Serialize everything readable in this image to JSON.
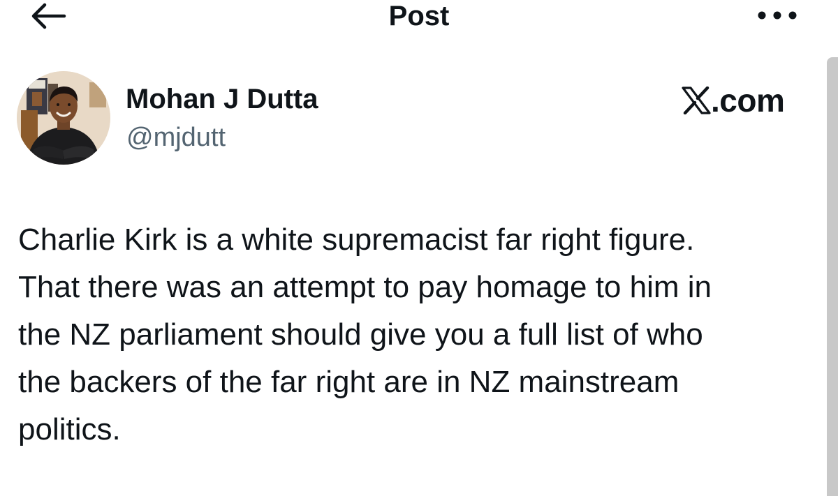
{
  "header": {
    "title": "Post",
    "back_icon": "arrow-left-icon",
    "more_icon": "more-horizontal-icon"
  },
  "author": {
    "name": "Mohan J Dutta",
    "handle": "@mjdutt",
    "avatar_icon": "profile-photo"
  },
  "brand": {
    "icon": "x-logo-icon",
    "text": ".com"
  },
  "post": {
    "lines": [
      "Charlie Kirk is a white supremacist far right figure.",
      "That there was an attempt to pay homage to him in",
      "the NZ parliament should give you a full list of who",
      "the backers of the far right are in NZ mainstream",
      "politics."
    ]
  },
  "colors": {
    "text_primary": "#0f1419",
    "text_secondary": "#536471",
    "background": "#ffffff",
    "scrollbar": "#c8c8c8"
  }
}
